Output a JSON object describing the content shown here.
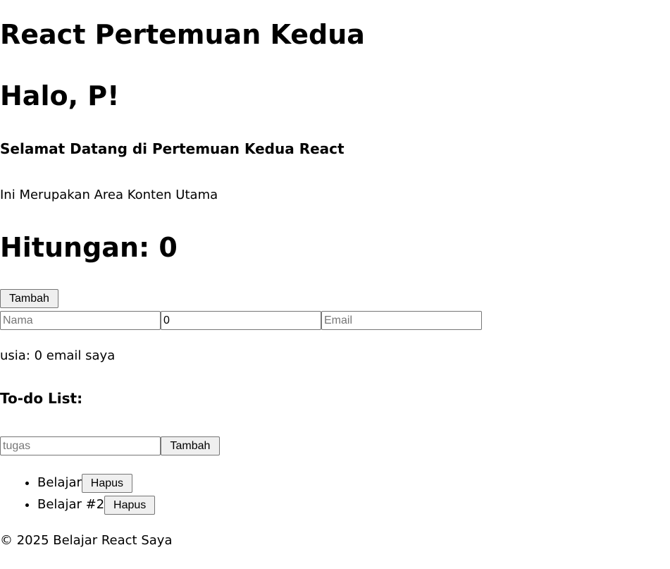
{
  "app": {
    "title": "React Pertemuan Kedua"
  },
  "greeting": "Halo, P!",
  "welcome": "Selamat Datang di Pertemuan Kedua React",
  "content_text": "Ini Merupakan Area Konten Utama",
  "counter": {
    "text": "Hitungan: 0",
    "add_label": "Tambah"
  },
  "form": {
    "name": {
      "value": "",
      "placeholder": "Nama"
    },
    "age": {
      "value": "0",
      "placeholder": ""
    },
    "email": {
      "value": "",
      "placeholder": "Email"
    },
    "summary": "usia: 0 email saya"
  },
  "todo": {
    "heading": "To-do List:",
    "task_input": {
      "value": "",
      "placeholder": "tugas"
    },
    "add_label": "Tambah",
    "items": [
      {
        "text": "Belajar",
        "delete_label": "Hapus"
      },
      {
        "text": "Belajar #2",
        "delete_label": "Hapus"
      }
    ]
  },
  "footer": "© 2025 Belajar React Saya"
}
